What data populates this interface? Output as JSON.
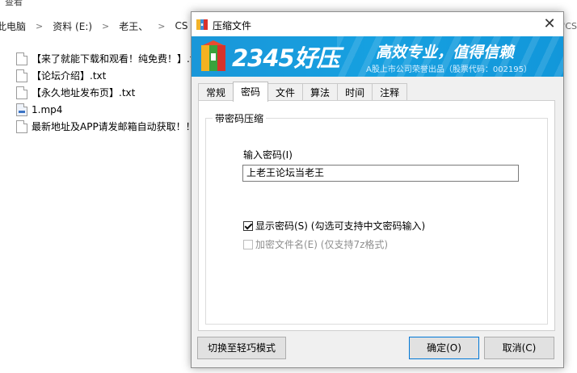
{
  "explorer": {
    "top_text": "查看",
    "breadcrumb": [
      "此电脑",
      "资料 (E:)",
      "老王、",
      "CS"
    ],
    "right_hint": "搜\"CS",
    "files": [
      {
        "name": "【来了就能下载和观看！纯免费！】.txt",
        "type": "txt"
      },
      {
        "name": "【论坛介绍】.txt",
        "type": "txt"
      },
      {
        "name": "【永久地址发布页】.txt",
        "type": "txt"
      },
      {
        "name": "1.mp4",
        "type": "mp4"
      },
      {
        "name": "最新地址及APP请发邮箱自动获取！！",
        "type": "txt"
      }
    ]
  },
  "dialog": {
    "title": "压缩文件",
    "close_glyph": "✕",
    "banner": {
      "brand": "2345好压",
      "slogan": "高效专业，值得信赖",
      "sub": "A股上市公司荣誉出品（股票代码：002195）"
    },
    "tabs": [
      "常规",
      "密码",
      "文件",
      "算法",
      "时间",
      "注释"
    ],
    "active_tab": "密码",
    "group_title": "带密码压缩",
    "password_label": "输入密码(I)",
    "password_value": "上老王论坛当老王",
    "show_password": {
      "label": "显示密码(S) (勾选可支持中文密码输入)",
      "checked": true
    },
    "encrypt_names": {
      "label": "加密文件名(E) (仅支持7z格式)",
      "checked": false,
      "disabled": true
    },
    "buttons": {
      "mode": "切换至轻巧模式",
      "ok": "确定(O)",
      "cancel": "取消(C)"
    }
  },
  "colors": {
    "banner": "#1a97d9",
    "accent": "#0078d7"
  }
}
